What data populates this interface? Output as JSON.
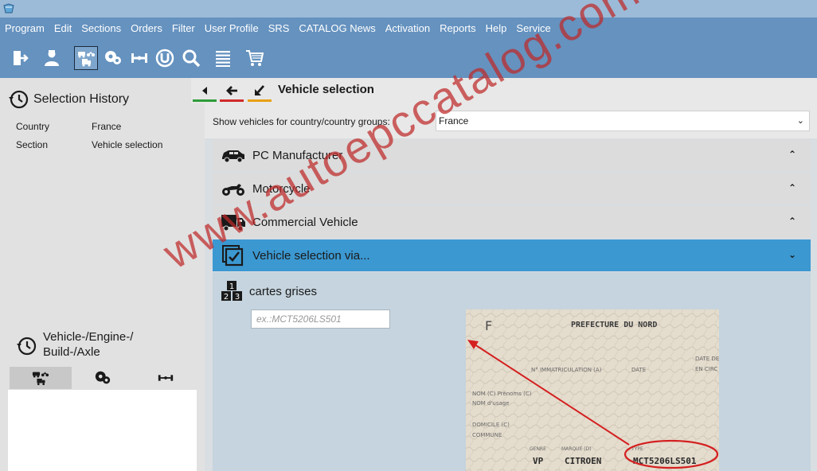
{
  "menu": [
    "Program",
    "Edit",
    "Sections",
    "Orders",
    "Filter",
    "User Profile",
    "SRS",
    "CATALOG News",
    "Activation",
    "Reports",
    "Help",
    "Service"
  ],
  "toolbar_icons": [
    "exit-icon",
    "user-icon",
    "vehicle-selection-icon",
    "engine-icon",
    "axle-icon",
    "universal-icon",
    "search-icon",
    "list-icon",
    "cart-icon"
  ],
  "left": {
    "history_title": "Selection History",
    "history": [
      {
        "label": "Country",
        "value": "France"
      },
      {
        "label": "Section",
        "value": "Vehicle selection"
      }
    ],
    "vehicle_title": "Vehicle-/Engine-/ Build-/Axle"
  },
  "header": {
    "title": "Vehicle selection"
  },
  "filter": {
    "label": "Show vehicles for country/country groups:",
    "value": "France"
  },
  "categories": [
    {
      "label": "PC Manufacturer",
      "arrow": "up"
    },
    {
      "label": "Motorcycle",
      "arrow": "up"
    },
    {
      "label": "Commercial Vehicle",
      "arrow": "up"
    },
    {
      "label": "Vehicle selection via...",
      "arrow": "down"
    }
  ],
  "content": {
    "method_label": "cartes grises",
    "input_placeholder": "ex.:MCT5206LS501",
    "doc": {
      "prefecture": "PREFECTURE DU NORD",
      "corner_letter": "F",
      "field_immat": "N° IMMATRICULATION (A)",
      "field_date": "DATE",
      "field_date2": "DATE DE",
      "field_date3": "EN CIRC",
      "field_nom": "NOM (C) Prénoms (C)",
      "field_usage": "NOM d'usage",
      "field_domicile": "DOMICILE (C)",
      "field_commune": "COMMUNE",
      "field_genre": "GENRE",
      "field_marque": "MARQUE (D)",
      "field_type": "TYPE",
      "genre": "VP",
      "marque": "CITROEN",
      "type_code": "MCT5206LS501"
    }
  },
  "watermark": "www.autoepccatalog.com",
  "colors": {
    "menubar": "#6592bf",
    "selected": "#3b98d1",
    "content": "#c5d4de",
    "watermark": "#be2828"
  }
}
